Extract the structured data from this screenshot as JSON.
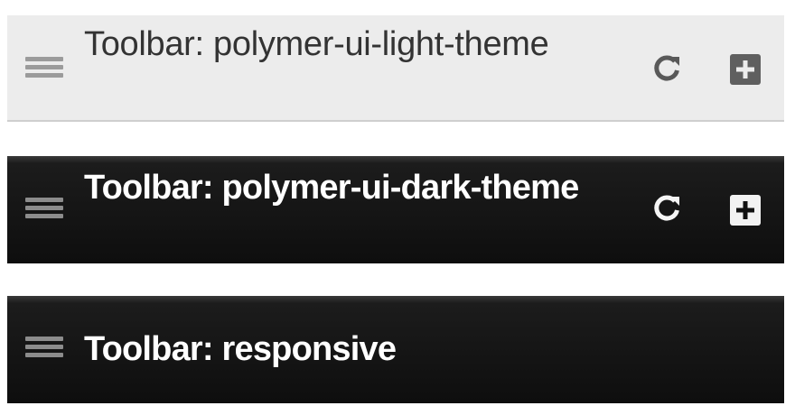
{
  "toolbars": [
    {
      "variant": "light",
      "title": "Toolbar: polymer-ui-light-theme",
      "icons": [
        "menu-icon",
        "refresh-icon",
        "add-icon"
      ],
      "colors": {
        "background": "#ececec",
        "text": "#333333"
      }
    },
    {
      "variant": "dark",
      "title": "Toolbar: polymer-ui-dark-theme",
      "icons": [
        "menu-icon",
        "refresh-icon",
        "add-icon"
      ],
      "colors": {
        "background": "#111111",
        "text": "#ffffff"
      }
    },
    {
      "variant": "responsive",
      "title": "Toolbar: responsive",
      "icons": [
        "menu-icon"
      ],
      "colors": {
        "background": "#111111",
        "text": "#ffffff"
      }
    }
  ]
}
